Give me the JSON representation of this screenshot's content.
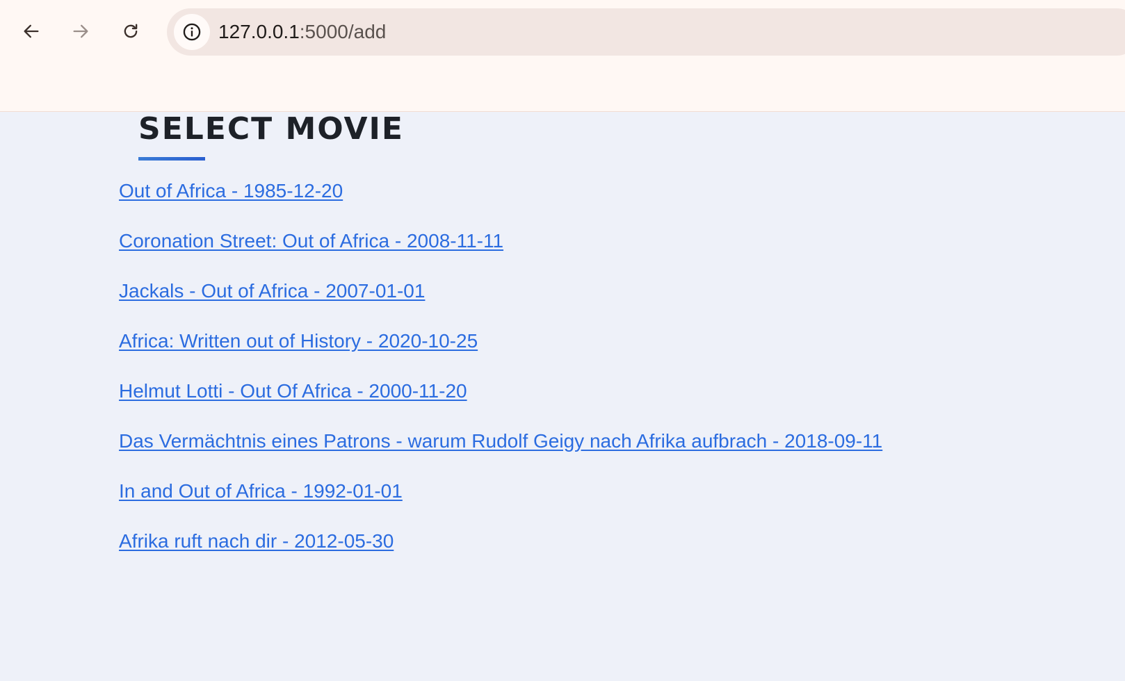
{
  "browser": {
    "url_host": "127.0.0.1",
    "url_path": ":5000/add",
    "icons": {
      "back": "back-arrow-icon",
      "forward": "forward-arrow-icon",
      "reload": "reload-icon",
      "info": "info-icon"
    }
  },
  "page": {
    "title": "SELECT MOVIE",
    "accent_color": "#2b6ce0",
    "movies": [
      {
        "label": "Out of Africa - 1985-12-20"
      },
      {
        "label": "Coronation Street: Out of Africa - 2008-11-11"
      },
      {
        "label": "Jackals - Out of Africa - 2007-01-01"
      },
      {
        "label": "Africa: Written out of History - 2020-10-25"
      },
      {
        "label": "Helmut Lotti - Out Of Africa - 2000-11-20"
      },
      {
        "label": "Das Vermächtnis eines Patrons - warum Rudolf Geigy nach Afrika aufbrach - 2018-09-11"
      },
      {
        "label": "In and Out of Africa - 1992-01-01"
      },
      {
        "label": "Afrika ruft nach dir - 2012-05-30"
      }
    ]
  }
}
